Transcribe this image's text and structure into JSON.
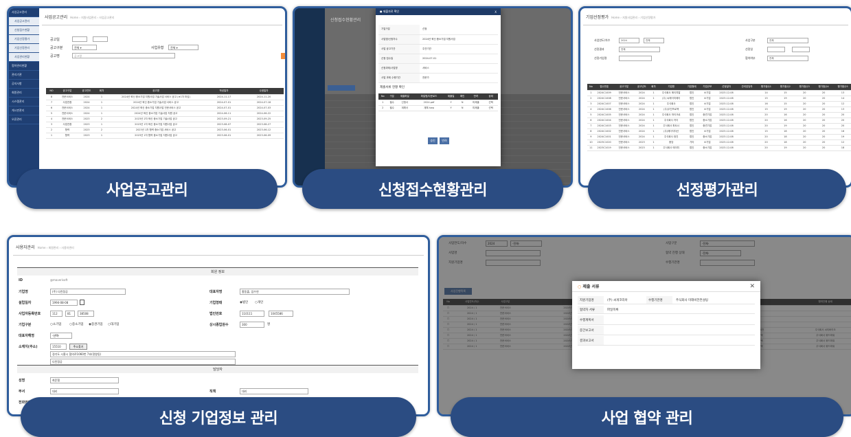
{
  "captions": {
    "c1": "사업공고관리",
    "c2": "신청접수현황관리",
    "c3": "선정평가관리",
    "c4": "신청 기업정보 관리",
    "c5": "사업 협약 관리"
  },
  "p1": {
    "title": "사업공고관리",
    "crumb": "Home › 지원사업관리 › 사업공고관리",
    "sidebar": [
      "사업공고관리",
      "사업공고관리",
      "신청접수현황",
      "기업선정평가",
      "기업선정관리",
      "사업관리현황",
      "협약관리현황",
      "관리기관",
      "공지사항",
      "회원관리",
      "시스템관리",
      "게시판관리",
      "오류관리"
    ],
    "filters": [
      "공고일",
      "공고구분",
      "공고명"
    ],
    "select": "전체",
    "select2": "전체",
    "filter3": "사업유형",
    "search_text": "공고명",
    "headers": [
      "NO",
      "공고구분",
      "공고연도",
      "회차",
      "공고명",
      "작성일자",
      "수정일자"
    ],
    "rows": [
      [
        "8",
        "전문서비스",
        "2024",
        "1",
        "2024년 혁신 중소기업 지원사업 기술사업 서비스 공고 (★1차 마감)",
        "2024-11-17",
        "2024-11-20"
      ],
      [
        "7",
        "사업전환",
        "2024",
        "1",
        "2024년 혁신 중소기업 기술사업 서비스 공고",
        "2024-07-01",
        "2024-07-18"
      ],
      [
        "6",
        "전문서비스",
        "2024",
        "1",
        "2024년 혁신 중소기업 지원사업 전문서비스 공고",
        "2024-07-01",
        "2024-07-03"
      ],
      [
        "5",
        "전문서비스",
        "2024",
        "1",
        "2024년 혁신 중소기업 기술사업 지원 공고",
        "2024-06-11",
        "2024-06-22"
      ],
      [
        "4",
        "전문서비스",
        "2023",
        "2",
        "2023년 2차 혁신 중소기업 기술사업 공고",
        "2023-09-21",
        "2023-09-25"
      ],
      [
        "3",
        "사업전환",
        "2023",
        "1",
        "2023년 1차 혁신 중소기업 지원사업 공고",
        "2023-08-07",
        "2023-08-27"
      ],
      [
        "2",
        "협력",
        "2023",
        "2",
        "2023년 1차 협력 중소기업 서비스 공고",
        "2023-06-01",
        "2023-06-12"
      ],
      [
        "1",
        "협력",
        "2023",
        "1",
        "2023년 1차 협력 중소기업 지원사업 공고",
        "2023-06-01",
        "2023-06-09"
      ]
    ]
  },
  "p2": {
    "title": "신청접수현황관리",
    "modal_title": "● 제출자료 확인",
    "modal_close": "X",
    "form_labels": [
      "기업구분",
      "사업명/신청차수",
      "사업 공고기관",
      "신청 접수일",
      "신청과제/사업명",
      "사업 과제 수행기관"
    ],
    "form_values": [
      "선정",
      "2024년 혁신 중소기업 지원사업",
      "주관기관",
      "2024-07-01",
      "서비스",
      "전문가"
    ],
    "section2": "제출서류 현황 확인",
    "sub_headers": [
      "No",
      "구분",
      "제출파일",
      "파일명/다운로드",
      "제출일",
      "확인",
      "반려",
      "상태"
    ],
    "sub_rows": [
      [
        "1",
        "필수",
        "신청서",
        "2024.pdf",
        "Y",
        "N",
        "미제출",
        "선택"
      ],
      [
        "2",
        "필수",
        "계획서",
        "계획.hwp",
        "Y",
        "N",
        "미제출",
        "선택"
      ]
    ],
    "btn_ok": "승인",
    "btn_cancel": "반려"
  },
  "p3": {
    "title": "기업선정평가",
    "crumb": "Home › 지원사업관리 › 기업선정평가",
    "labels": [
      "사업연도/차수",
      "선정결과",
      "선정기업명",
      "사업구분",
      "선정일",
      "협약여부"
    ],
    "year": "2024",
    "all": "전체",
    "headers": [
      "No",
      "접수번호",
      "공고구분",
      "공고년도",
      "회차",
      "기업명",
      "기업형태",
      "기업규모",
      "선정일자",
      "관리담당자",
      "평가점수1",
      "평가점수2",
      "평가점수3",
      "평가점수4",
      "평가점수5"
    ],
    "rows": [
      [
        "1",
        "2024C1009",
        "전문서비스",
        "2024",
        "1",
        "주식회사 에이치알",
        "법인",
        "소기업",
        "2023-12-08",
        "",
        "14",
        "15",
        "20",
        "20",
        "13"
      ],
      [
        "2",
        "2024C1008",
        "전문서비스",
        "2024",
        "1",
        "(주) 씨에이치제이",
        "법인",
        "소기업",
        "2023-12-08",
        "",
        "15",
        "19",
        "20",
        "20",
        "14"
      ],
      [
        "3",
        "2024C1007",
        "전문서비스",
        "2024",
        "1",
        "주식회사",
        "법인",
        "소기업",
        "2023-12-08",
        "",
        "16",
        "15",
        "20",
        "20",
        "12"
      ],
      [
        "4",
        "2024C1006",
        "전문서비스",
        "2024",
        "1",
        "(주)우진프로젝",
        "법인",
        "소기업",
        "2023-12-08",
        "",
        "15",
        "19",
        "20",
        "20",
        "13"
      ],
      [
        "5",
        "2024C1005",
        "전문서비스",
        "2024",
        "1",
        "주식회사 마이크로",
        "법인",
        "중견기업",
        "2023-12-08",
        "",
        "20",
        "16",
        "20",
        "20",
        "20"
      ],
      [
        "6",
        "2024C1004",
        "전문서비스",
        "2024",
        "1",
        "주식회사 카이",
        "법인",
        "중소기업",
        "2023-12-08",
        "",
        "20",
        "16",
        "20",
        "20",
        "20"
      ],
      [
        "7",
        "2024C1003",
        "전문서비스",
        "2024",
        "1",
        "주식회사 파트너",
        "법인",
        "중견기업",
        "2023-12-08",
        "",
        "20",
        "19",
        "20",
        "20",
        "20"
      ],
      [
        "8",
        "2024C1002",
        "전문서비스",
        "2024",
        "1",
        "(주)에이지자산",
        "법인",
        "소기업",
        "2023-12-08",
        "",
        "15",
        "18",
        "20",
        "20",
        "16"
      ],
      [
        "9",
        "2024C1001",
        "전문서비스",
        "2024",
        "1",
        "주식회사 정진",
        "법인",
        "중소기업",
        "2023-12-08",
        "",
        "20",
        "18",
        "20",
        "20",
        "19"
      ],
      [
        "10",
        "2023C1020",
        "전문서비스",
        "2023",
        "1",
        "중앙",
        "기타",
        "소기업",
        "2023-12-08",
        "",
        "20",
        "18",
        "20",
        "20",
        "12"
      ],
      [
        "11",
        "2023C1019",
        "전문서비스",
        "2023",
        "1",
        "주식회사 에이치",
        "법인",
        "중소기업",
        "2023-12-08",
        "",
        "20",
        "19",
        "20",
        "20",
        "18"
      ]
    ]
  },
  "p4": {
    "title": "사용자관리",
    "crumb": "Home › 회원관리 › 사용자관리",
    "section1": "회원 정보",
    "section2": "담당자",
    "left_labels": [
      "ID",
      "기업명",
      "설립일자",
      "사업자등록번호",
      "기업구분",
      "대표자해명",
      "소재지(주소)"
    ],
    "id_value": "@maverisoft",
    "company": "(주) 다린정공",
    "date": "1994-08-08",
    "bizno": [
      "112",
      "81",
      "38508"
    ],
    "kinds": [
      "소기업",
      "중소기업",
      "중견기업",
      "대기업"
    ],
    "rep_select": "-선택-",
    "zip": "15510",
    "zip_btn": "주소찾기",
    "addr1": "경기도 시흥시 협의로1060번 7호(정왕동)",
    "addr2": "다린정공",
    "right_labels": [
      "대표자명",
      "기업형태",
      "법인번호",
      "상시종업원수"
    ],
    "rep_name": "홍동출, 임수연",
    "corp_kinds": [
      "법인",
      "개인"
    ],
    "corpno": [
      "110111",
      "1045586"
    ],
    "employees": "300",
    "emp_unit": "명",
    "manager_labels": [
      "성명",
      "부서",
      "전화번호"
    ],
    "manager": "최운철",
    "dept": "대리",
    "pos_label": "직책",
    "pos": "대리"
  },
  "p5": {
    "title": "사업 협약 관리",
    "filter_labels": [
      "사업연도/차수",
      "사업명",
      "지원기업명",
      "사업구분",
      "협약 진행 상태",
      "수행기관명"
    ],
    "year": "2024",
    "all": "-전체-",
    "btn_list": "사업진행목록",
    "modal_title": "제출 서류",
    "modal_close": "✕",
    "m_labels": [
      "지원기업명",
      "수행기관명"
    ],
    "m_values": [
      "(주) 씨게코리아",
      "주식회사 미래비전컨설팅"
    ],
    "m_headers": [
      "협약자 서류",
      "파일목록"
    ],
    "m_rows": [
      "수행계획서",
      "중간보고서",
      "결과보고서"
    ],
    "headers": [
      "No",
      "사업연도/차수",
      "사업구분",
      "사업명",
      "지원기업명",
      "수행기관명",
      "협약진행 상태"
    ],
    "rows": [
      [
        "2024 / 1",
        "전문서비스",
        "2024년 혁신 중소기업 지원사업",
        "주식회사 미래비전컨설팅"
      ],
      [
        "2024 / 1",
        "전문서비스",
        "2024년 혁신 중소기업 지원사업",
        "주식회사 미래비전컨설팅"
      ],
      [
        "2024 / 1",
        "전문서비스",
        "2024년 혁신 중소기업 지원사업",
        "주식회사 비전네트워크"
      ],
      [
        "2024 / 1",
        "전문서비스",
        "2024년 혁신 중소기업 지원사업",
        "주식회사 씨티바이오"
      ],
      [
        "2024 / 1",
        "전문서비스",
        "2024년 혁신 중소기업 지원사업",
        "주식회사 씨티바이오"
      ],
      [
        "2024 / 1",
        "전문서비스",
        "2024년 혁신 중소기업 지원사업",
        "주식회사 위드파워"
      ],
      [
        "2024 / 1",
        "전문서비스",
        "2024년 혁신 중소기업 지원사업",
        "주식회사 위드파워"
      ],
      [
        "2024 / 1",
        "전문서비스",
        "2024년 혁신 중소기업 지원사업",
        "주식회사 위드파워"
      ]
    ],
    "extra": [
      [
        "중앙",
        "주식회사 미래비전",
        "주식회사 씨게코리아"
      ],
      [
        "(주)씨게코리아",
        "주식회사 아이텍",
        "주식회사 위드파워"
      ],
      [
        "(주)엘케이엔비",
        "주식회사 아이텍",
        "주식회사 위드파워"
      ],
      [
        "다이노팜",
        "주식회사 아이텍",
        "주식회사 위드파워"
      ]
    ]
  }
}
